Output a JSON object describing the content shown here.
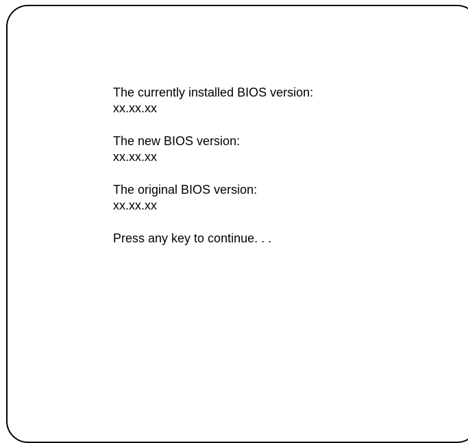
{
  "bios_info": {
    "installed_label": "The currently installed BIOS version:",
    "installed_value": "xx.xx.xx",
    "new_label": "The new BIOS version:",
    "new_value": "xx.xx.xx",
    "original_label": "The original BIOS version:",
    "original_value": "xx.xx.xx"
  },
  "prompt": {
    "continue_text": "Press any key to continue. . ."
  }
}
